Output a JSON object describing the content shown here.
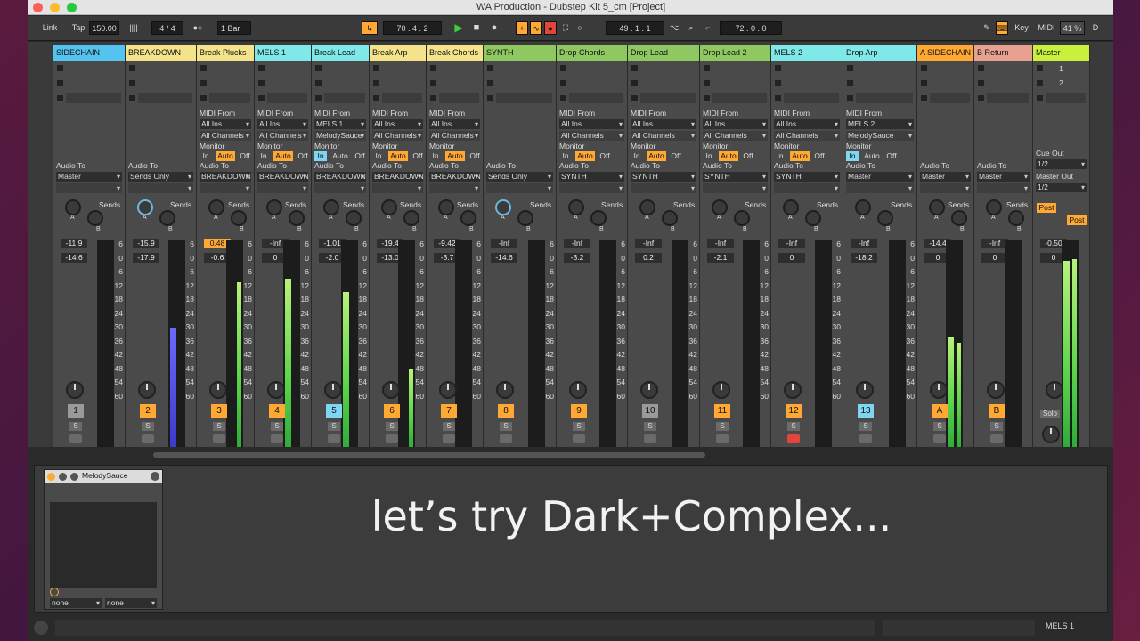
{
  "window": {
    "title": "WA Production - Dubstep Kit 5_cm  [Project]"
  },
  "transport": {
    "link": "Link",
    "tap": "Tap",
    "tempo": "150.00",
    "sig": "4 / 4",
    "quant": "1 Bar",
    "pos": "70 .  4 .  2",
    "loop_start": "49 .  1 .  1",
    "loop_len": "72 .  0 .  0",
    "key": "Key",
    "midi": "MIDI",
    "cpu": "41 %",
    "d": "D"
  },
  "tracks": [
    {
      "name": "SIDECHAIN",
      "color": "#55c3ef",
      "midi_from": "",
      "ins": "",
      "ch": "",
      "audio_to": "Master",
      "vol": "-11.9",
      "peak": "-14.6",
      "num": "1",
      "num_color": "#9a9a9a"
    },
    {
      "name": "BREAKDOWN",
      "color": "#f4e38a",
      "midi_from": "",
      "ins": "",
      "ch": "",
      "audio_to": "Sends Only",
      "vol": "-15.9",
      "peak": "-17.9",
      "num": "2",
      "num_color": "#ffa833"
    },
    {
      "name": "Break Plucks",
      "color": "#f4e38a",
      "midi_from": "MIDI From",
      "ins": "All Ins",
      "ch": "All Channels",
      "audio_to": "BREAKDOWN",
      "vol": "0.48",
      "peak": "-0.6",
      "num": "3",
      "num_color": "#ffa833"
    },
    {
      "name": "MELS 1",
      "color": "#7fe8e8",
      "midi_from": "MIDI From",
      "ins": "All Ins",
      "ch": "All Channels",
      "audio_to": "BREAKDOWN",
      "vol": "-Inf",
      "peak": "0",
      "num": "4",
      "num_color": "#ffa833"
    },
    {
      "name": "Break Lead",
      "color": "#7fe8e8",
      "midi_from": "MIDI From",
      "ins": "MELS 1",
      "ch": "MelodySauce",
      "audio_to": "BREAKDOWN",
      "vol": "-1.01",
      "peak": "-2.0",
      "num": "5",
      "num_color": "#7fd6f2"
    },
    {
      "name": "Break Arp",
      "color": "#f4e38a",
      "midi_from": "MIDI From",
      "ins": "All Ins",
      "ch": "All Channels",
      "audio_to": "BREAKDOWN",
      "vol": "-19.4",
      "peak": "-13.0",
      "num": "6",
      "num_color": "#ffa833"
    },
    {
      "name": "Break Chords",
      "color": "#f4e38a",
      "midi_from": "MIDI From",
      "ins": "All Ins",
      "ch": "All Channels",
      "audio_to": "BREAKDOWN",
      "vol": "-9.42",
      "peak": "-3.7",
      "num": "7",
      "num_color": "#ffa833"
    },
    {
      "name": "SYNTH",
      "color": "#8fc860",
      "midi_from": "",
      "ins": "",
      "ch": "",
      "audio_to": "Sends Only",
      "vol": "-Inf",
      "peak": "-14.6",
      "num": "8",
      "num_color": "#ffa833"
    },
    {
      "name": "Drop Chords",
      "color": "#8fc860",
      "midi_from": "MIDI From",
      "ins": "All Ins",
      "ch": "All Channels",
      "audio_to": "SYNTH",
      "vol": "-Inf",
      "peak": "-3.2",
      "num": "9",
      "num_color": "#ffa833"
    },
    {
      "name": "Drop Lead",
      "color": "#8fc860",
      "midi_from": "MIDI From",
      "ins": "All Ins",
      "ch": "All Channels",
      "audio_to": "SYNTH",
      "vol": "-Inf",
      "peak": "0.2",
      "num": "10",
      "num_color": "#9a9a9a"
    },
    {
      "name": "Drop Lead 2",
      "color": "#8fc860",
      "midi_from": "MIDI From",
      "ins": "All Ins",
      "ch": "All Channels",
      "audio_to": "SYNTH",
      "vol": "-Inf",
      "peak": "-2.1",
      "num": "11",
      "num_color": "#ffa833"
    },
    {
      "name": "MELS 2",
      "color": "#7fe8e8",
      "midi_from": "MIDI From",
      "ins": "All Ins",
      "ch": "All Channels",
      "audio_to": "SYNTH",
      "vol": "-Inf",
      "peak": "0",
      "num": "12",
      "num_color": "#ffa833"
    },
    {
      "name": "Drop Arp",
      "color": "#7fe8e8",
      "midi_from": "MIDI From",
      "ins": "MELS 2",
      "ch": "MelodySauce",
      "audio_to": "Master",
      "vol": "-Inf",
      "peak": "-18.2",
      "num": "13",
      "num_color": "#7fd6f2"
    },
    {
      "name": "A SIDECHAIN",
      "color": "#ffa833",
      "midi_from": "",
      "ins": "",
      "ch": "",
      "audio_to": "Master",
      "vol": "-14.4",
      "peak": "0",
      "num": "A",
      "num_color": "#ffa833"
    },
    {
      "name": "B Return",
      "color": "#e8a090",
      "midi_from": "",
      "ins": "",
      "ch": "",
      "audio_to": "Master",
      "vol": "-Inf",
      "peak": "0",
      "num": "B",
      "num_color": "#ffa833"
    },
    {
      "name": "Master",
      "color": "#c8f03c",
      "midi_from": "",
      "ins": "",
      "ch": "",
      "audio_to": "",
      "vol": "-0.50",
      "peak": "0",
      "num": "",
      "num_color": ""
    }
  ],
  "labels": {
    "monitor": "Monitor",
    "in": "In",
    "auto": "Auto",
    "off": "Off",
    "audio_to": "Audio To",
    "sends": "Sends",
    "a": "A",
    "b": "B",
    "s": "S",
    "cue_out": "Cue Out",
    "cue_val": "1/2",
    "master_out": "Master Out",
    "master_val": "1/2",
    "post": "Post",
    "solo": "Solo",
    "scene1": "1",
    "scene2": "2"
  },
  "scale": [
    "6",
    "0",
    "6",
    "12",
    "18",
    "24",
    "30",
    "36",
    "42",
    "48",
    "54",
    "60"
  ],
  "device": {
    "name": "MelodySauce",
    "sel1": "none",
    "sel2": "none"
  },
  "subtitle": "let’s try Dark+Complex...",
  "status": {
    "track": "MELS 1"
  }
}
